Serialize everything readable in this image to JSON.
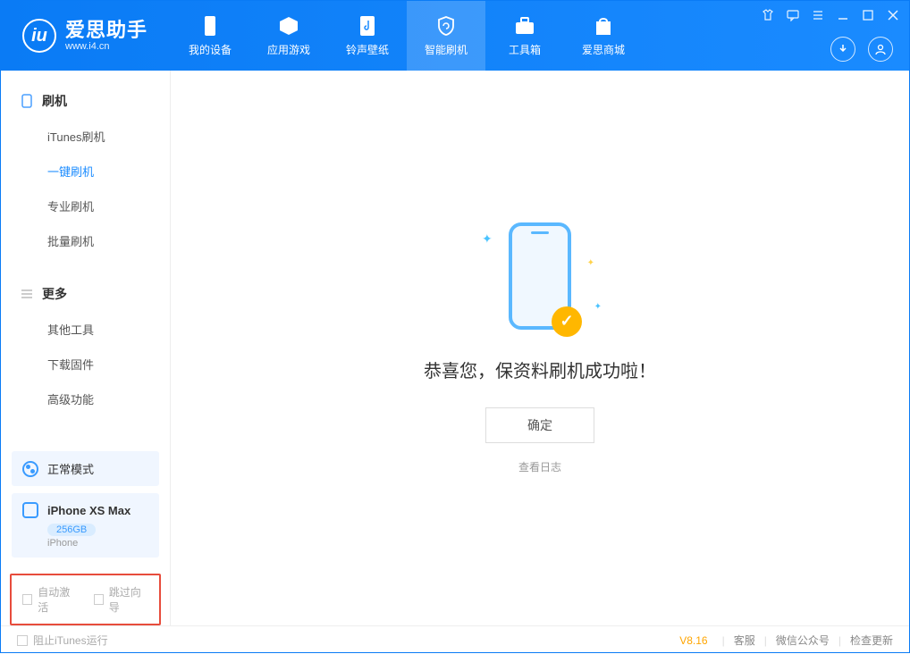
{
  "app": {
    "title": "爱思助手",
    "url": "www.i4.cn"
  },
  "tabs": [
    {
      "label": "我的设备"
    },
    {
      "label": "应用游戏"
    },
    {
      "label": "铃声壁纸"
    },
    {
      "label": "智能刷机"
    },
    {
      "label": "工具箱"
    },
    {
      "label": "爱思商城"
    }
  ],
  "sidebar": {
    "section1": {
      "title": "刷机",
      "items": [
        "iTunes刷机",
        "一键刷机",
        "专业刷机",
        "批量刷机"
      ]
    },
    "section2": {
      "title": "更多",
      "items": [
        "其他工具",
        "下载固件",
        "高级功能"
      ]
    }
  },
  "mode": {
    "label": "正常模式"
  },
  "device": {
    "name": "iPhone XS Max",
    "storage": "256GB",
    "type": "iPhone"
  },
  "options": {
    "auto_activate": "自动激活",
    "skip_guide": "跳过向导"
  },
  "result": {
    "title": "恭喜您，保资料刷机成功啦！",
    "ok": "确定",
    "view_log": "查看日志"
  },
  "status": {
    "block_itunes": "阻止iTunes运行",
    "version": "V8.16",
    "links": [
      "客服",
      "微信公众号",
      "检查更新"
    ]
  }
}
